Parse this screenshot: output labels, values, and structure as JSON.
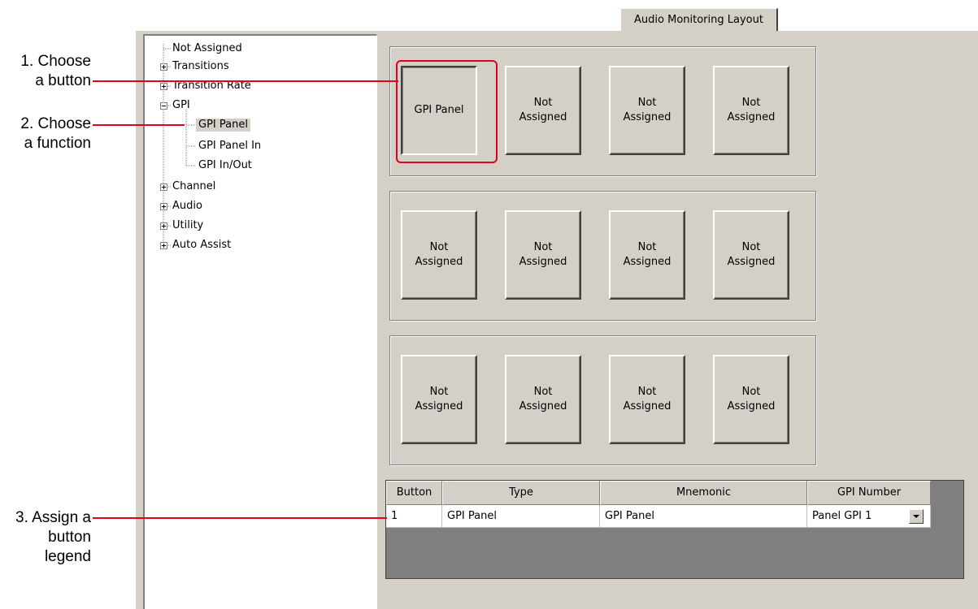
{
  "tab": {
    "label": "Audio Monitoring Layout"
  },
  "tree": {
    "items": [
      {
        "label": "Not Assigned",
        "expander": "none"
      },
      {
        "label": "Transitions",
        "expander": "plus"
      },
      {
        "label": "Transition Rate",
        "expander": "plus"
      },
      {
        "label": "GPI",
        "expander": "minus",
        "children": [
          {
            "label": "GPI Panel",
            "selected": true
          },
          {
            "label": "GPI Panel In"
          },
          {
            "label": "GPI In/Out"
          }
        ]
      },
      {
        "label": "Channel",
        "expander": "plus"
      },
      {
        "label": "Audio",
        "expander": "plus"
      },
      {
        "label": "Utility",
        "expander": "plus"
      },
      {
        "label": "Auto Assist",
        "expander": "plus"
      }
    ]
  },
  "button_groups": [
    {
      "buttons": [
        {
          "label": "GPI Panel",
          "pressed": true
        },
        {
          "label": "Not\nAssigned"
        },
        {
          "label": "Not\nAssigned"
        },
        {
          "label": "Not\nAssigned"
        }
      ]
    },
    {
      "buttons": [
        {
          "label": "Not\nAssigned"
        },
        {
          "label": "Not\nAssigned"
        },
        {
          "label": "Not\nAssigned"
        },
        {
          "label": "Not\nAssigned"
        }
      ]
    },
    {
      "buttons": [
        {
          "label": "Not\nAssigned"
        },
        {
          "label": "Not\nAssigned"
        },
        {
          "label": "Not\nAssigned"
        },
        {
          "label": "Not\nAssigned"
        }
      ]
    }
  ],
  "grid": {
    "columns": [
      "Button",
      "Type",
      "Mnemonic",
      "GPI Number"
    ],
    "rows": [
      {
        "button": "1",
        "type": "GPI Panel",
        "mnemonic": "GPI Panel",
        "gpi_number": "Panel GPI 1"
      }
    ]
  },
  "callouts": [
    {
      "text": "1. Choose\na button"
    },
    {
      "text": "2. Choose\na function"
    },
    {
      "text": "3. Assign a\nbutton\nlegend"
    }
  ],
  "colors": {
    "panel": "#d4d0c8",
    "callout_line": "#e2001a",
    "grid_bg": "#808080"
  }
}
